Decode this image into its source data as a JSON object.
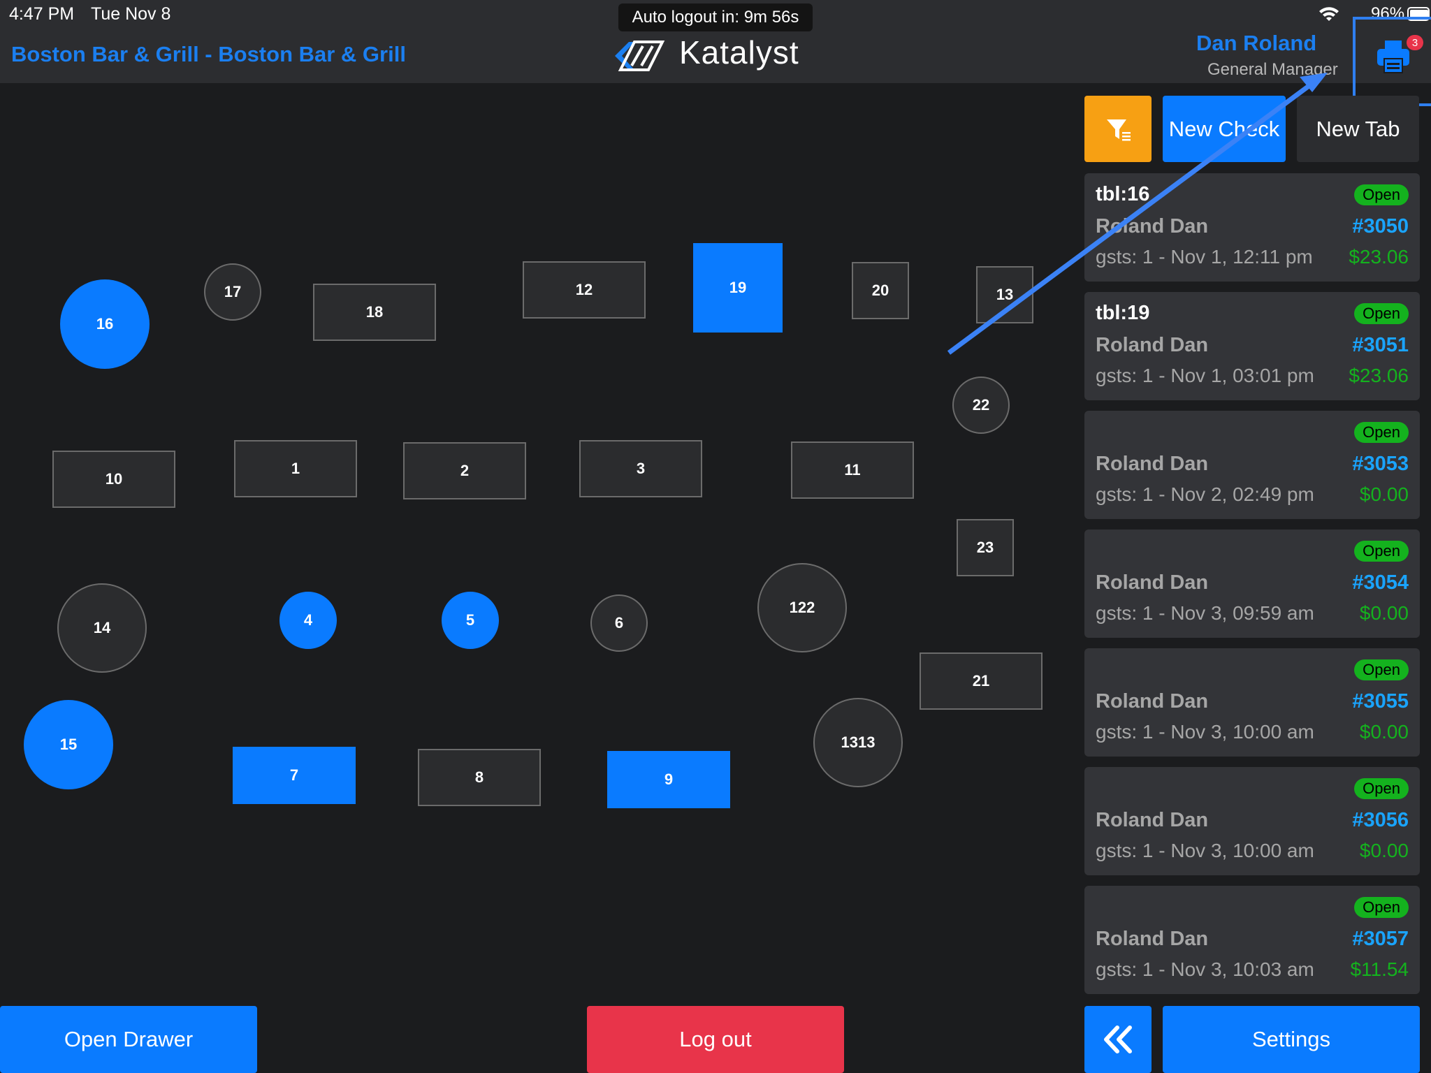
{
  "status_bar": {
    "time": "4:47 PM",
    "date": "Tue Nov 8",
    "battery": "96%",
    "auto_logout": "Auto logout in: 9m 56s"
  },
  "header": {
    "restaurant": "Boston Bar & Grill - Boston Bar & Grill",
    "app_name": "Katalyst",
    "user_name": "Dan Roland",
    "user_role": "General Manager",
    "printer_badge": "3"
  },
  "colors": {
    "accent": "#0a7bff",
    "background": "#1b1c1e",
    "header": "#2c2d30",
    "table": "#2b2c2e",
    "filter": "#f7a013",
    "logout": "#e8344a",
    "status_open": "#14b21e",
    "check_number": "#1aa4ff"
  },
  "icons": [
    "wifi-icon",
    "battery-icon",
    "katalyst-logo-icon",
    "printer-icon",
    "filter-icon",
    "double-chevron-left-icon"
  ],
  "tables": [
    {
      "id": "t16",
      "label": "16",
      "shape": "round",
      "occupied": true
    },
    {
      "id": "t17",
      "label": "17",
      "shape": "round",
      "occupied": false
    },
    {
      "id": "t18",
      "label": "18",
      "shape": "rect",
      "occupied": false
    },
    {
      "id": "t12",
      "label": "12",
      "shape": "rect",
      "occupied": false
    },
    {
      "id": "t19",
      "label": "19",
      "shape": "rect",
      "occupied": true
    },
    {
      "id": "t20",
      "label": "20",
      "shape": "rect",
      "occupied": false
    },
    {
      "id": "t13",
      "label": "13",
      "shape": "rect",
      "occupied": false
    },
    {
      "id": "t22",
      "label": "22",
      "shape": "round",
      "occupied": false
    },
    {
      "id": "t10",
      "label": "10",
      "shape": "rect",
      "occupied": false
    },
    {
      "id": "t1",
      "label": "1",
      "shape": "rect",
      "occupied": false
    },
    {
      "id": "t2",
      "label": "2",
      "shape": "rect",
      "occupied": false
    },
    {
      "id": "t3",
      "label": "3",
      "shape": "rect",
      "occupied": false
    },
    {
      "id": "t11",
      "label": "11",
      "shape": "rect",
      "occupied": false
    },
    {
      "id": "t23",
      "label": "23",
      "shape": "rect",
      "occupied": false
    },
    {
      "id": "t14",
      "label": "14",
      "shape": "round",
      "occupied": false
    },
    {
      "id": "t4",
      "label": "4",
      "shape": "round",
      "occupied": true
    },
    {
      "id": "t5",
      "label": "5",
      "shape": "round",
      "occupied": true
    },
    {
      "id": "t6",
      "label": "6",
      "shape": "round",
      "occupied": false
    },
    {
      "id": "t122",
      "label": "122",
      "shape": "round",
      "occupied": false
    },
    {
      "id": "t21",
      "label": "21",
      "shape": "rect",
      "occupied": false
    },
    {
      "id": "t15",
      "label": "15",
      "shape": "round",
      "occupied": true
    },
    {
      "id": "t7",
      "label": "7",
      "shape": "rect",
      "occupied": true
    },
    {
      "id": "t8",
      "label": "8",
      "shape": "rect",
      "occupied": false
    },
    {
      "id": "t9",
      "label": "9",
      "shape": "rect",
      "occupied": true
    },
    {
      "id": "t1313",
      "label": "1313",
      "shape": "round",
      "occupied": false
    }
  ],
  "panel": {
    "new_check": "New Check",
    "new_tab": "New Tab",
    "checks": [
      {
        "table": "tbl:16",
        "status": "Open",
        "server": "Roland Dan",
        "number": "#3050",
        "guests": "gsts: 1 - Nov 1, 12:11 pm",
        "amount": "$23.06"
      },
      {
        "table": "tbl:19",
        "status": "Open",
        "server": "Roland Dan",
        "number": "#3051",
        "guests": "gsts: 1 - Nov 1, 03:01 pm",
        "amount": "$23.06"
      },
      {
        "table": "",
        "status": "Open",
        "server": "Roland Dan",
        "number": "#3053",
        "guests": "gsts: 1 - Nov 2, 02:49 pm",
        "amount": "$0.00"
      },
      {
        "table": "",
        "status": "Open",
        "server": "Roland Dan",
        "number": "#3054",
        "guests": "gsts: 1 - Nov 3, 09:59 am",
        "amount": "$0.00"
      },
      {
        "table": "",
        "status": "Open",
        "server": "Roland Dan",
        "number": "#3055",
        "guests": "gsts: 1 - Nov 3, 10:00 am",
        "amount": "$0.00"
      },
      {
        "table": "",
        "status": "Open",
        "server": "Roland Dan",
        "number": "#3056",
        "guests": "gsts: 1 - Nov 3, 10:00 am",
        "amount": "$0.00"
      },
      {
        "table": "",
        "status": "Open",
        "server": "Roland Dan",
        "number": "#3057",
        "guests": "gsts: 1 - Nov 3, 10:03 am",
        "amount": "$11.54"
      }
    ]
  },
  "footer": {
    "open_drawer": "Open Drawer",
    "log_out": "Log out",
    "settings": "Settings"
  }
}
